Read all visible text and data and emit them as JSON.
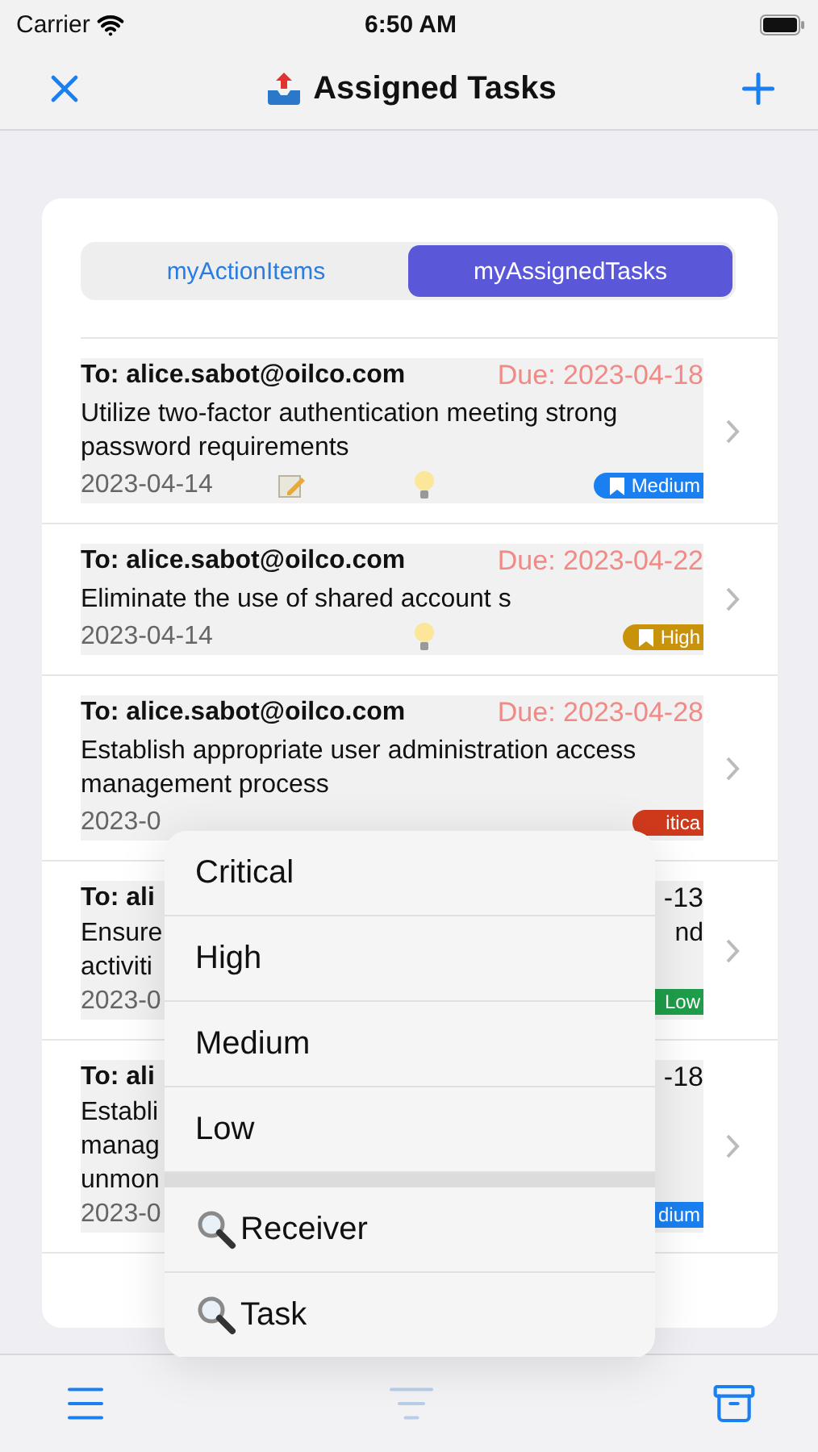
{
  "status_bar": {
    "carrier": "Carrier",
    "time": "6:50 AM"
  },
  "nav": {
    "title": "Assigned Tasks"
  },
  "segments": [
    {
      "label": "myActionItems",
      "selected": false
    },
    {
      "label": "myAssignedTasks",
      "selected": true
    }
  ],
  "rows": [
    {
      "kind": "full",
      "to": "To: alice.sabot@oilco.com",
      "due": "Due: 2023-04-18",
      "title": "Utilize two-factor authentication meeting strong password requirements",
      "date": "2023-04-14",
      "note": true,
      "idea": true,
      "badge": {
        "label": "Medium",
        "color": "#1a7ff0",
        "bookmark": true
      }
    },
    {
      "kind": "full",
      "to": "To: alice.sabot@oilco.com",
      "due": "Due: 2023-04-22",
      "title": "Eliminate the use of shared account s",
      "date": "2023-04-14",
      "note": false,
      "idea": true,
      "badge": {
        "label": "High",
        "color": "#c8930a",
        "bookmark": true
      }
    },
    {
      "kind": "full",
      "to": "To: alice.sabot@oilco.com",
      "due": "Due: 2023-04-28",
      "title": "Establish appropriate user administration access management process",
      "date": "2023-0",
      "note": false,
      "idea": false,
      "badge": {
        "label": "itica",
        "color": "#d03a1c",
        "bookmark": false
      }
    },
    {
      "kind": "covered",
      "to": "To: ali",
      "due": "-13",
      "left_lines": [
        "Ensure",
        "activiti"
      ],
      "right_lines": [
        "nd"
      ],
      "date": "2023-0",
      "badge": {
        "label": "Low",
        "color": "#1f9d4a",
        "bookmark": false
      }
    },
    {
      "kind": "covered",
      "to": "To: ali",
      "due": "-18",
      "left_lines": [
        "Establi",
        "manag",
        "unmon"
      ],
      "right_lines": [],
      "date": "2023-0",
      "badge": {
        "label": "dium",
        "color": "#1a7ff0",
        "bookmark": false
      }
    }
  ],
  "menu": [
    {
      "kind": "option",
      "label": "Critical"
    },
    {
      "kind": "option",
      "label": "High"
    },
    {
      "kind": "option",
      "label": "Medium"
    },
    {
      "kind": "option",
      "label": "Low"
    },
    {
      "kind": "search",
      "label": "Receiver"
    },
    {
      "kind": "search",
      "label": "Task"
    }
  ],
  "toolbar": [
    {
      "kind": "menu",
      "disabled": false
    },
    {
      "kind": "filter",
      "disabled": true
    },
    {
      "kind": "archive",
      "disabled": false
    }
  ]
}
